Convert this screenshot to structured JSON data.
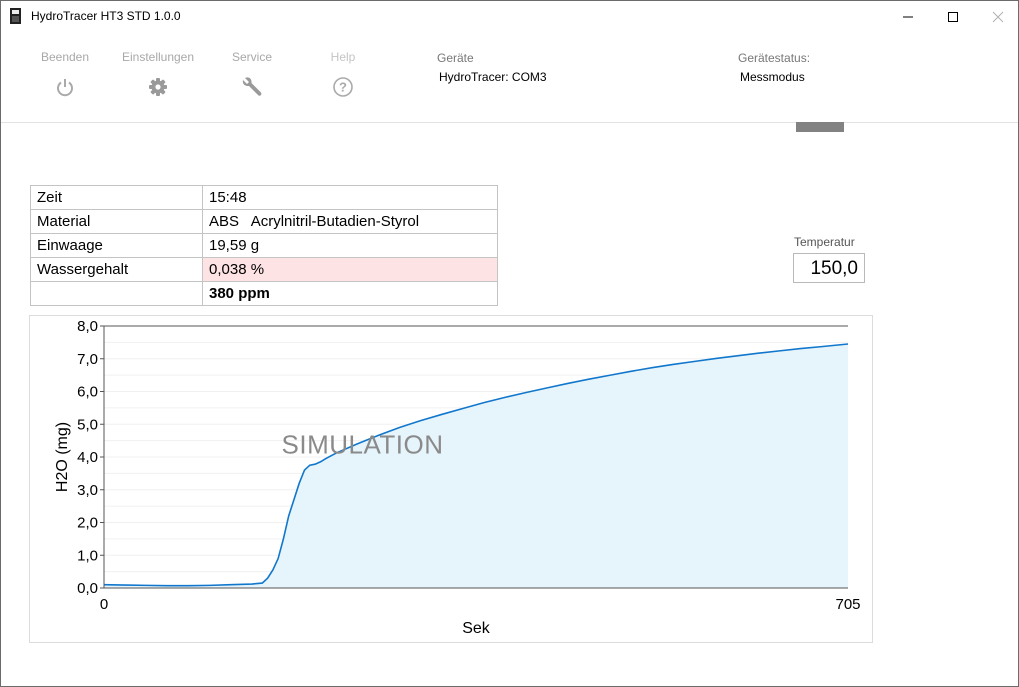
{
  "window": {
    "title": "HydroTracer HT3 STD 1.0.0",
    "minimize_glyph": "—",
    "maximize_glyph": "☐",
    "close_glyph": "✕"
  },
  "toolbar": {
    "items": [
      {
        "label": "Beenden",
        "icon": "power-icon"
      },
      {
        "label": "Einstellungen",
        "icon": "gear-icon"
      },
      {
        "label": "Service",
        "icon": "wrench-icon"
      },
      {
        "label": "Help",
        "icon": "help-icon"
      }
    ],
    "devices_label": "Geräte",
    "devices_value": "HydroTracer: COM3",
    "status_label": "Gerätestatus:",
    "status_value": "Messmodus"
  },
  "info_table": {
    "rows": [
      {
        "key": "Zeit",
        "value": "15:48"
      },
      {
        "key": "Material",
        "value": "ABS   Acrylnitril-Butadien-Styrol"
      },
      {
        "key": "Einwaage",
        "value": "19,59 g"
      },
      {
        "key": "Wassergehalt",
        "value": "0,038 %"
      },
      {
        "key": "",
        "value": "380 ppm"
      }
    ]
  },
  "temperature": {
    "label": "Temperatur",
    "value": "150,0"
  },
  "colors": {
    "line": "#1177cc",
    "fill": "#e6f4fb",
    "highlight_row": "#fde3e3",
    "watermark": "#8a8a8a"
  },
  "chart_data": {
    "type": "area",
    "xlabel": "Sek",
    "ylabel": "H2O (mg)",
    "xlim": [
      0,
      705
    ],
    "ylim": [
      0,
      8
    ],
    "x_ticks": [
      "0",
      "705"
    ],
    "y_ticks": [
      "0,0",
      "1,0",
      "2,0",
      "3,0",
      "4,0",
      "5,0",
      "6,0",
      "7,0",
      "8,0"
    ],
    "watermark": "SIMULATION",
    "grid": true,
    "series": [
      {
        "x": [
          0,
          20,
          40,
          60,
          80,
          100,
          120,
          140,
          150,
          155,
          160,
          165,
          170,
          175,
          180,
          185,
          190,
          195,
          200,
          205,
          210,
          220,
          240,
          260,
          280,
          300,
          320,
          340,
          360,
          380,
          400,
          420,
          440,
          460,
          480,
          500,
          520,
          540,
          560,
          580,
          600,
          620,
          640,
          660,
          680,
          705
        ],
        "y": [
          0.1,
          0.09,
          0.08,
          0.07,
          0.07,
          0.08,
          0.1,
          0.12,
          0.15,
          0.3,
          0.55,
          0.9,
          1.5,
          2.2,
          2.7,
          3.2,
          3.6,
          3.75,
          3.78,
          3.85,
          3.95,
          4.12,
          4.4,
          4.66,
          4.9,
          5.11,
          5.3,
          5.48,
          5.66,
          5.82,
          5.97,
          6.11,
          6.25,
          6.38,
          6.5,
          6.62,
          6.73,
          6.83,
          6.92,
          7.01,
          7.09,
          7.17,
          7.24,
          7.31,
          7.37,
          7.45
        ]
      }
    ]
  }
}
